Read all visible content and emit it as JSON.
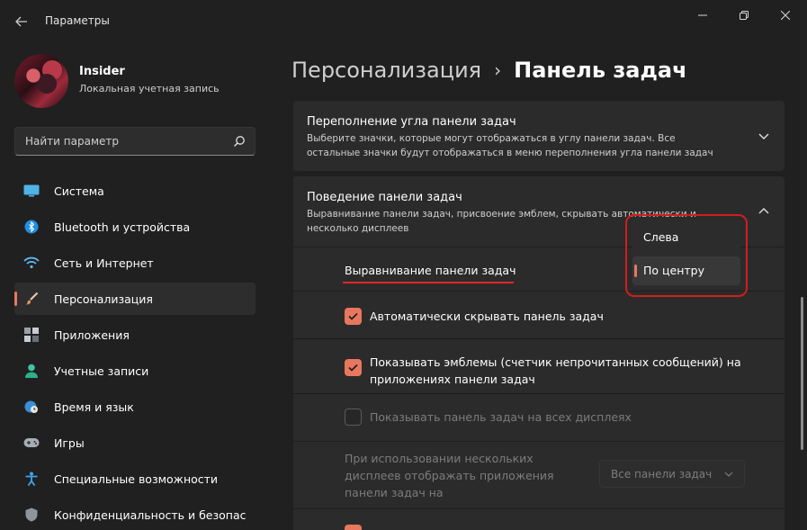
{
  "window": {
    "title": "Параметры"
  },
  "profile": {
    "name": "Insider",
    "account_type": "Локальная учетная запись"
  },
  "search": {
    "placeholder": "Найти параметр"
  },
  "sidebar": {
    "items": [
      {
        "label": "Система",
        "icon": "system-icon"
      },
      {
        "label": "Bluetooth и устройства",
        "icon": "bluetooth-icon"
      },
      {
        "label": "Сеть и Интернет",
        "icon": "wifi-icon"
      },
      {
        "label": "Персонализация",
        "icon": "brush-icon",
        "active": true
      },
      {
        "label": "Приложения",
        "icon": "apps-icon"
      },
      {
        "label": "Учетные записи",
        "icon": "person-icon"
      },
      {
        "label": "Время и язык",
        "icon": "globe-clock-icon"
      },
      {
        "label": "Игры",
        "icon": "gamepad-icon"
      },
      {
        "label": "Специальные возможности",
        "icon": "accessibility-icon"
      },
      {
        "label": "Конфиденциальность и безопас",
        "icon": "shield-icon"
      }
    ]
  },
  "header": {
    "parent": "Персонализация",
    "separator": "›",
    "current": "Панель задач"
  },
  "cards": {
    "overflow": {
      "title": "Переполнение угла панели задач",
      "description": "Выберите значки, которые могут отображаться в углу панели задач. Все остальные значки будут отображаться в меню переполнения угла панели задач"
    },
    "behavior": {
      "title": "Поведение панели задач",
      "description": "Выравнивание панели задач, присвоение эмблем, скрывать автоматически и несколько дисплеев"
    }
  },
  "settings": {
    "alignment_label": "Выравнивание панели задач",
    "auto_hide": {
      "label": "Автоматически скрывать панель задач",
      "checked": true
    },
    "badges": {
      "label": "Показывать эмблемы (счетчик непрочитанных сообщений) на приложениях панели задач",
      "checked": true
    },
    "all_displays": {
      "label": "Показывать панель задач на всех дисплеях",
      "checked": false,
      "disabled": true
    },
    "multi_display": {
      "label": "При использовании нескольких дисплеев отображать приложения панели задач на",
      "selected": "Все панели задач",
      "disabled": true
    }
  },
  "alignment_flyout": {
    "options": [
      "Слева",
      "По центру"
    ],
    "selected": "По центру"
  },
  "colors": {
    "accent": "#e8775f",
    "annotation_red": "#d21d1d",
    "background": "#202020",
    "card": "#2b2b2b"
  }
}
